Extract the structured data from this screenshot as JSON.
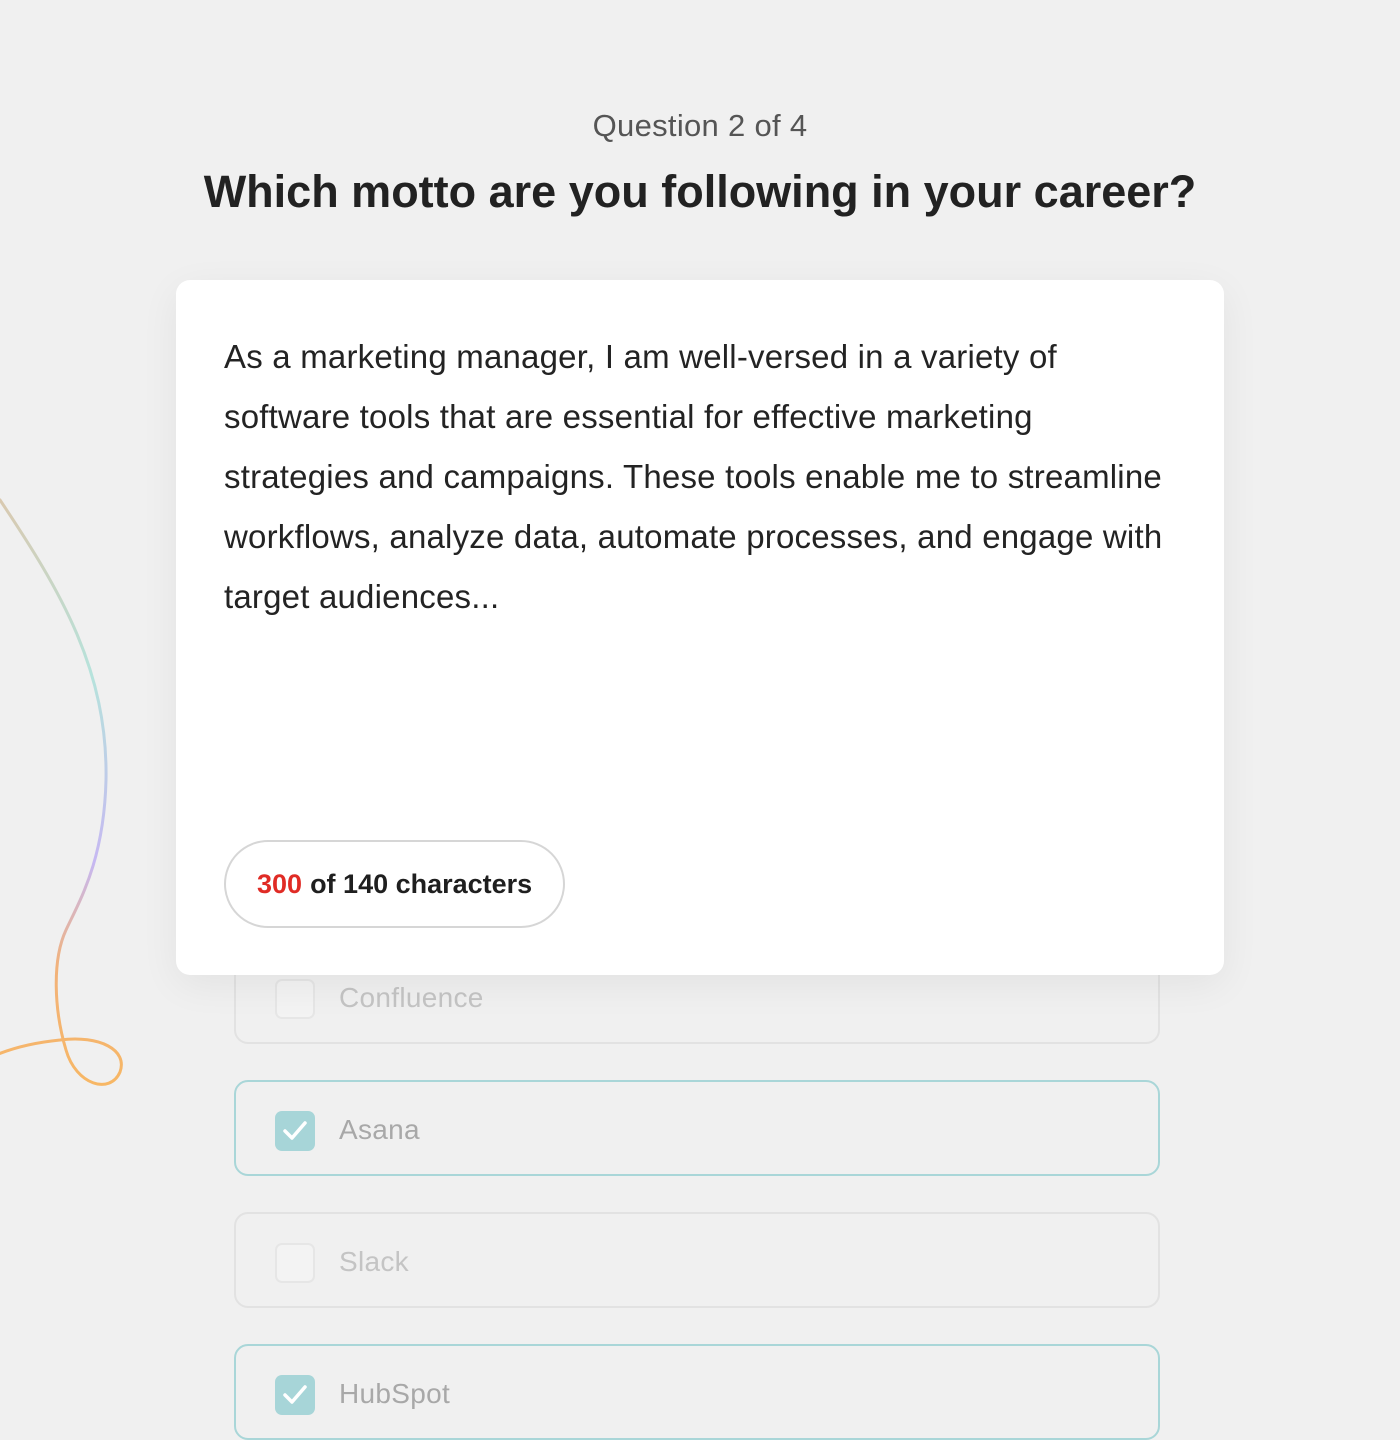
{
  "header": {
    "progress": "Question 2 of 4",
    "title": "Which motto are you following in your career?"
  },
  "answer": {
    "text": "As a marketing manager, I am well-versed in a variety of software tools that are essential for effective marketing strategies and campaigns. These tools enable me to streamline workflows, analyze data, automate processes, and engage with target audiences..."
  },
  "counter": {
    "current": "300",
    "limit_text": "of 140 characters"
  },
  "options": [
    {
      "label": "Confluence",
      "checked": false
    },
    {
      "label": "Asana",
      "checked": true
    },
    {
      "label": "Slack",
      "checked": false
    },
    {
      "label": "HubSpot",
      "checked": true
    }
  ],
  "colors": {
    "background": "#f0f0f0",
    "card": "#ffffff",
    "counter_over_limit": "#e02b25",
    "checked_accent": "#a7d5d8"
  }
}
